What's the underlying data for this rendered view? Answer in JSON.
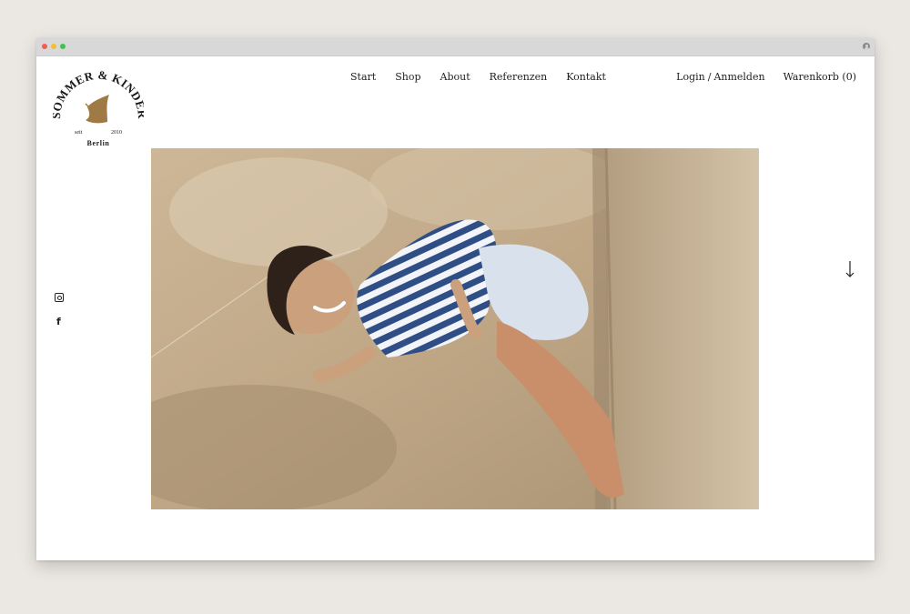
{
  "brand": {
    "top_text": "SOMMER & KINDER",
    "since_left": "seit",
    "since_right": "2010",
    "city": "Berlin",
    "accent_color": "#a07a45"
  },
  "nav": {
    "items": [
      "Start",
      "Shop",
      "About",
      "Referenzen",
      "Kontakt"
    ]
  },
  "account": {
    "login": "Login",
    "separator": "/",
    "register": "Anmelden",
    "cart": "Warenkorb (0)"
  },
  "social": {
    "icons": [
      "instagram-icon",
      "facebook-icon"
    ],
    "facebook_glyph": "f"
  },
  "scroll": {
    "icon": "arrow-down-icon"
  },
  "colors": {
    "background": "#ebe8e3",
    "page": "#ffffff",
    "text": "#222222"
  }
}
